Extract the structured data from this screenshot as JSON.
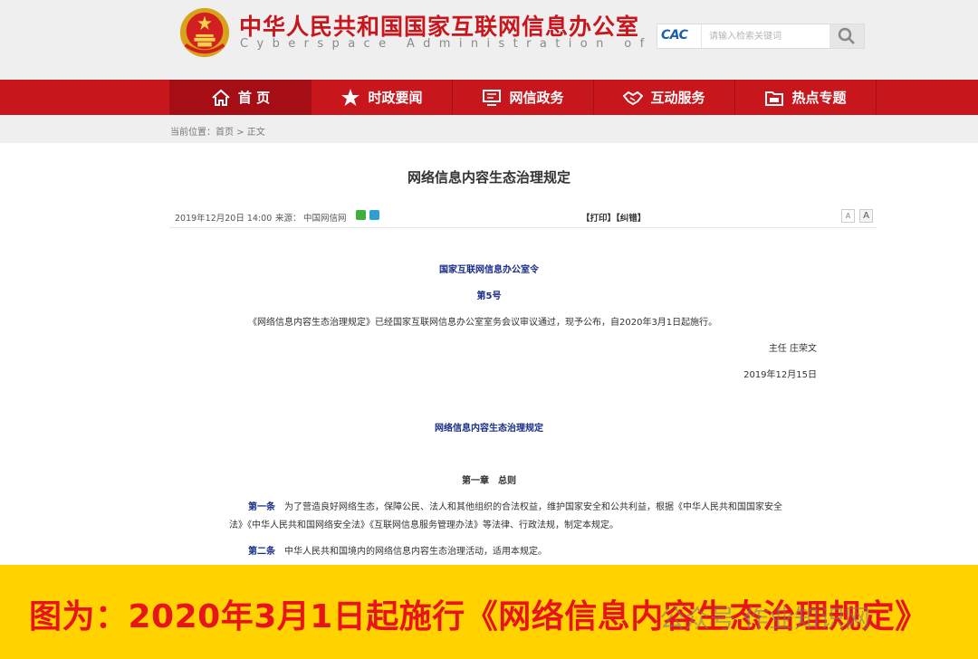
{
  "header": {
    "title_cn": "中华人民共和国国家互联网信息办公室",
    "title_en": "Cyberspace Administration of China",
    "search_logo": "CAC",
    "search_placeholder": "请输入检索关键词"
  },
  "nav": {
    "items": [
      {
        "label": "首 页",
        "icon": "home-icon"
      },
      {
        "label": "时政要闻",
        "icon": "star-icon"
      },
      {
        "label": "网信政务",
        "icon": "monitor-icon"
      },
      {
        "label": "互动服务",
        "icon": "handshake-icon"
      },
      {
        "label": "热点专题",
        "icon": "folder-icon"
      }
    ]
  },
  "breadcrumb": {
    "label": "当前位置：",
    "home": "首页",
    "sep": " > ",
    "current": "正文"
  },
  "article": {
    "title": "网络信息内容生态治理规定",
    "date": "2019年12月20日 14:00",
    "source_label": "来源：",
    "source": "中国网信网",
    "print": "【打印】",
    "correct": "【纠错】",
    "font_small": "A",
    "font_large": "A",
    "order_title": "国家互联网信息办公室令",
    "order_no": "第5号",
    "announce": "《网络信息内容生态治理规定》已经国家互联网信息办公室室务会议审议通过，现予公布，自2020年3月1日起施行。",
    "signer": "主任 庄荣文",
    "sign_date": "2019年12月15日",
    "reg_title": "网络信息内容生态治理规定",
    "chapter1": "第一章　总则",
    "art1_label": "第一条",
    "art1_line1": "　为了营造良好网络生态，保障公民、法人和其他组织的合法权益，维护国家安全和公共利益，根据《中华人民共和国国家安全",
    "art1_line2": "法》《中华人民共和国网络安全法》《互联网信息服务管理办法》等法律、行政法规，制定本规定。",
    "art2_label": "第二条",
    "art2_text": "　中华人民共和国境内的网络信息内容生态治理活动，适用本规定。"
  },
  "banner": {
    "text": "图为：2020年3月1日起施行《网络信息内容生态治理规定》",
    "watermark": "公众号 作业知识网"
  },
  "colors": {
    "brand_red": "#c8161d",
    "nav_active": "#a50e14",
    "text_blue": "#1a2d86",
    "banner_yellow": "#ffd200",
    "banner_text": "#e8141b"
  }
}
